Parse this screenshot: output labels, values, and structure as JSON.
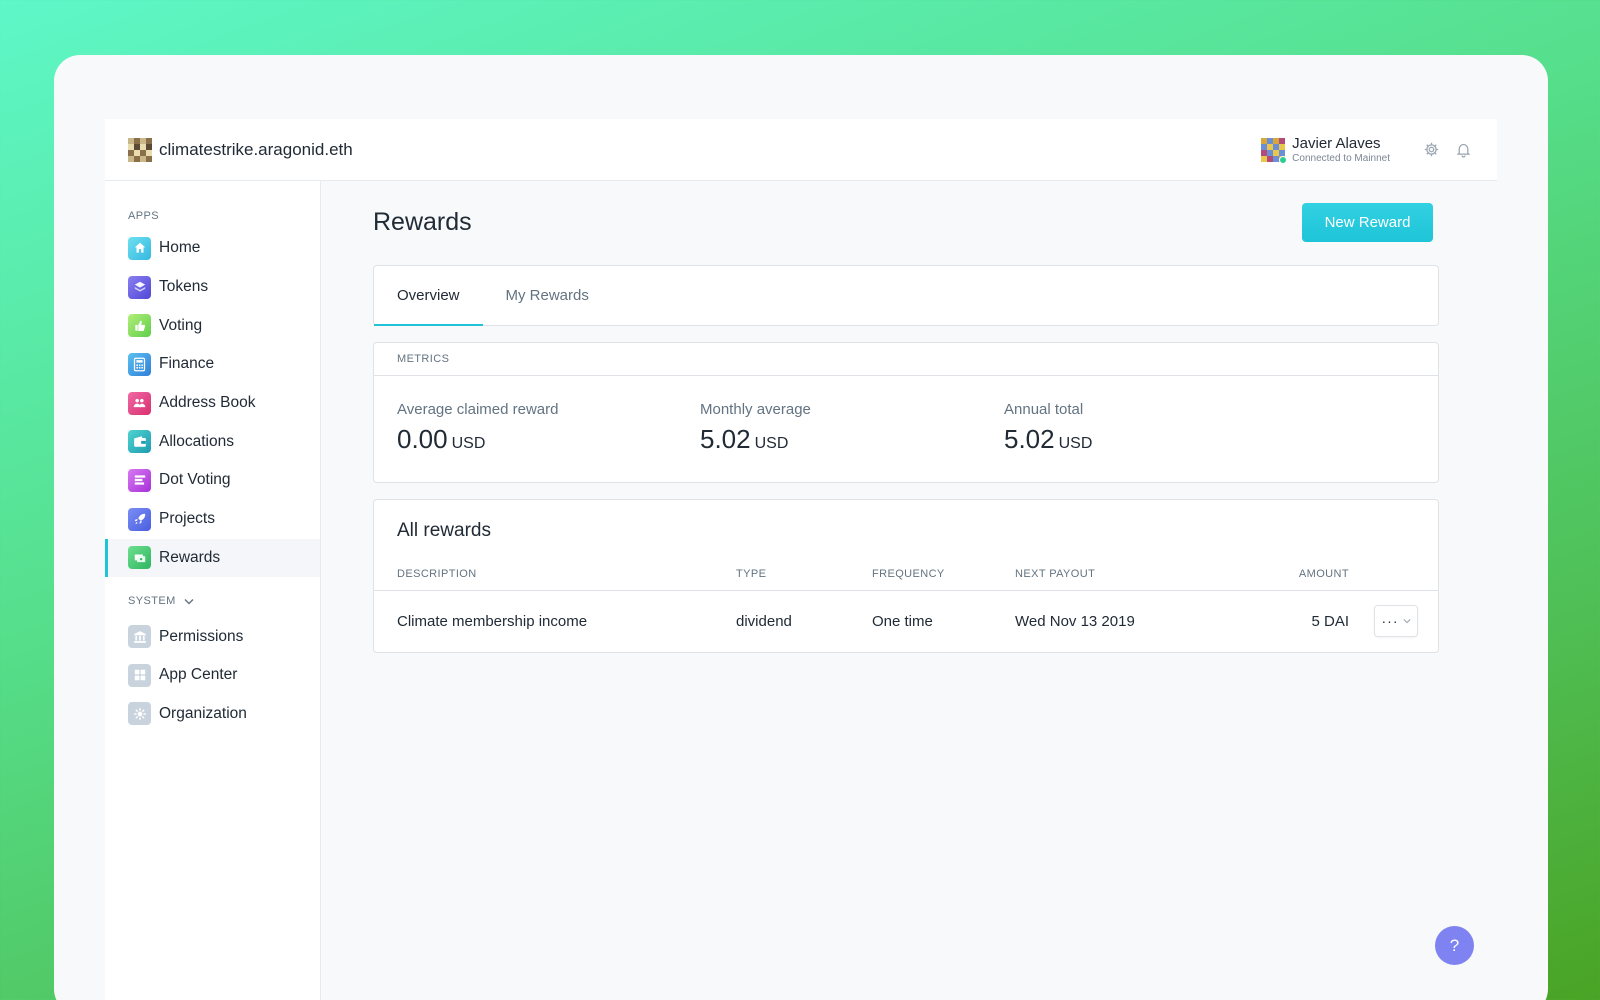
{
  "header": {
    "org_name": "climatestrike.aragonid.eth",
    "user_name": "Javier Alaves",
    "user_status": "Connected to Mainnet",
    "icons": [
      "settings-gear-icon",
      "notification-bell-icon"
    ]
  },
  "sidebar": {
    "apps_label": "APPS",
    "apps": [
      {
        "label": "Home",
        "icon": "home-icon",
        "color": "#45c7e6"
      },
      {
        "label": "Tokens",
        "icon": "tokens-icon",
        "color": "#6a61e8"
      },
      {
        "label": "Voting",
        "icon": "voting-icon",
        "color": "#8fdc5e"
      },
      {
        "label": "Finance",
        "icon": "finance-icon",
        "color": "#3a9be6"
      },
      {
        "label": "Address Book",
        "icon": "address-book-icon",
        "color": "#e8468a"
      },
      {
        "label": "Allocations",
        "icon": "allocations-icon",
        "color": "#28b7c0"
      },
      {
        "label": "Dot Voting",
        "icon": "dot-voting-icon",
        "color": "#c04be8"
      },
      {
        "label": "Projects",
        "icon": "projects-icon",
        "color": "#5a7cf0"
      },
      {
        "label": "Rewards",
        "icon": "rewards-icon",
        "color": "#3cc777"
      }
    ],
    "system_label": "SYSTEM",
    "system": [
      {
        "label": "Permissions",
        "icon": "permissions-icon"
      },
      {
        "label": "App Center",
        "icon": "app-center-icon"
      },
      {
        "label": "Organization",
        "icon": "organization-icon"
      }
    ]
  },
  "page": {
    "title": "Rewards",
    "new_button": "New Reward",
    "tabs": [
      {
        "label": "Overview"
      },
      {
        "label": "My Rewards"
      }
    ]
  },
  "metrics": {
    "heading": "METRICS",
    "items": [
      {
        "label": "Average claimed reward",
        "value": "0.00",
        "unit": "USD"
      },
      {
        "label": "Monthly average",
        "value": "5.02",
        "unit": "USD"
      },
      {
        "label": "Annual total",
        "value": "5.02",
        "unit": "USD"
      }
    ]
  },
  "rewards": {
    "title": "All rewards",
    "columns": {
      "description": "DESCRIPTION",
      "type": "TYPE",
      "frequency": "FREQUENCY",
      "next_payout": "NEXT PAYOUT",
      "amount": "AMOUNT"
    },
    "rows": [
      {
        "description": "Climate membership income",
        "type": "dividend",
        "frequency": "One time",
        "next_payout": "Wed Nov 13 2019",
        "amount": "5 DAI",
        "menu": "···"
      }
    ]
  },
  "help": {
    "label": "?"
  },
  "colors": {
    "accent": "#22c3d9",
    "help": "#7f83f2"
  }
}
